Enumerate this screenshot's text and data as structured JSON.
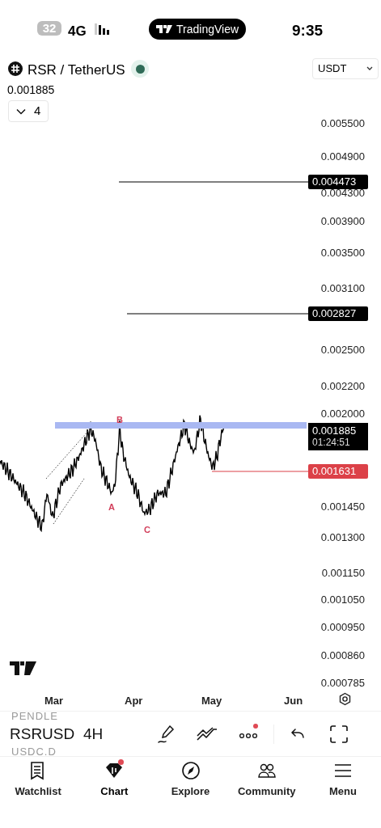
{
  "status_bar": {
    "battery": "32",
    "network": "4G",
    "app_pill": "TradingView",
    "time": "9:35"
  },
  "symbol": {
    "title": "RSR / TetherUS",
    "currency": "USDT",
    "last_price": "0.001885",
    "indicators_count": "4"
  },
  "chart": {
    "price_axis": [
      "0.005500",
      "0.004900",
      "0.004300",
      "0.003900",
      "0.003500",
      "0.003100",
      "0.002500",
      "0.002200",
      "0.002000",
      "0.001450",
      "0.001300",
      "0.001150",
      "0.001050",
      "0.000950",
      "0.000860",
      "0.000785"
    ],
    "price_tags": [
      {
        "value": "0.004473",
        "color": "#000000"
      },
      {
        "value": "0.002827",
        "color": "#000000"
      },
      {
        "value": "0.001631",
        "color": "#dc4148"
      }
    ],
    "current_price": {
      "value": "0.001885",
      "countdown": "01:24:51"
    },
    "wave_labels": [
      "B",
      "A",
      "C"
    ],
    "time_axis": [
      "Mar",
      "Apr",
      "May",
      "Jun"
    ]
  },
  "toolbar": {
    "symbol_above": "PENDLE",
    "symbol": "RSRUSD",
    "symbol_below": "USDC.D",
    "interval": "4H",
    "more_notification": true
  },
  "nav": [
    {
      "label": "Watchlist",
      "selected": false,
      "notification": false
    },
    {
      "label": "Chart",
      "selected": true,
      "notification": true
    },
    {
      "label": "Explore",
      "selected": false,
      "notification": false
    },
    {
      "label": "Community",
      "selected": false,
      "notification": false
    },
    {
      "label": "Menu",
      "selected": false,
      "notification": false
    }
  ]
}
